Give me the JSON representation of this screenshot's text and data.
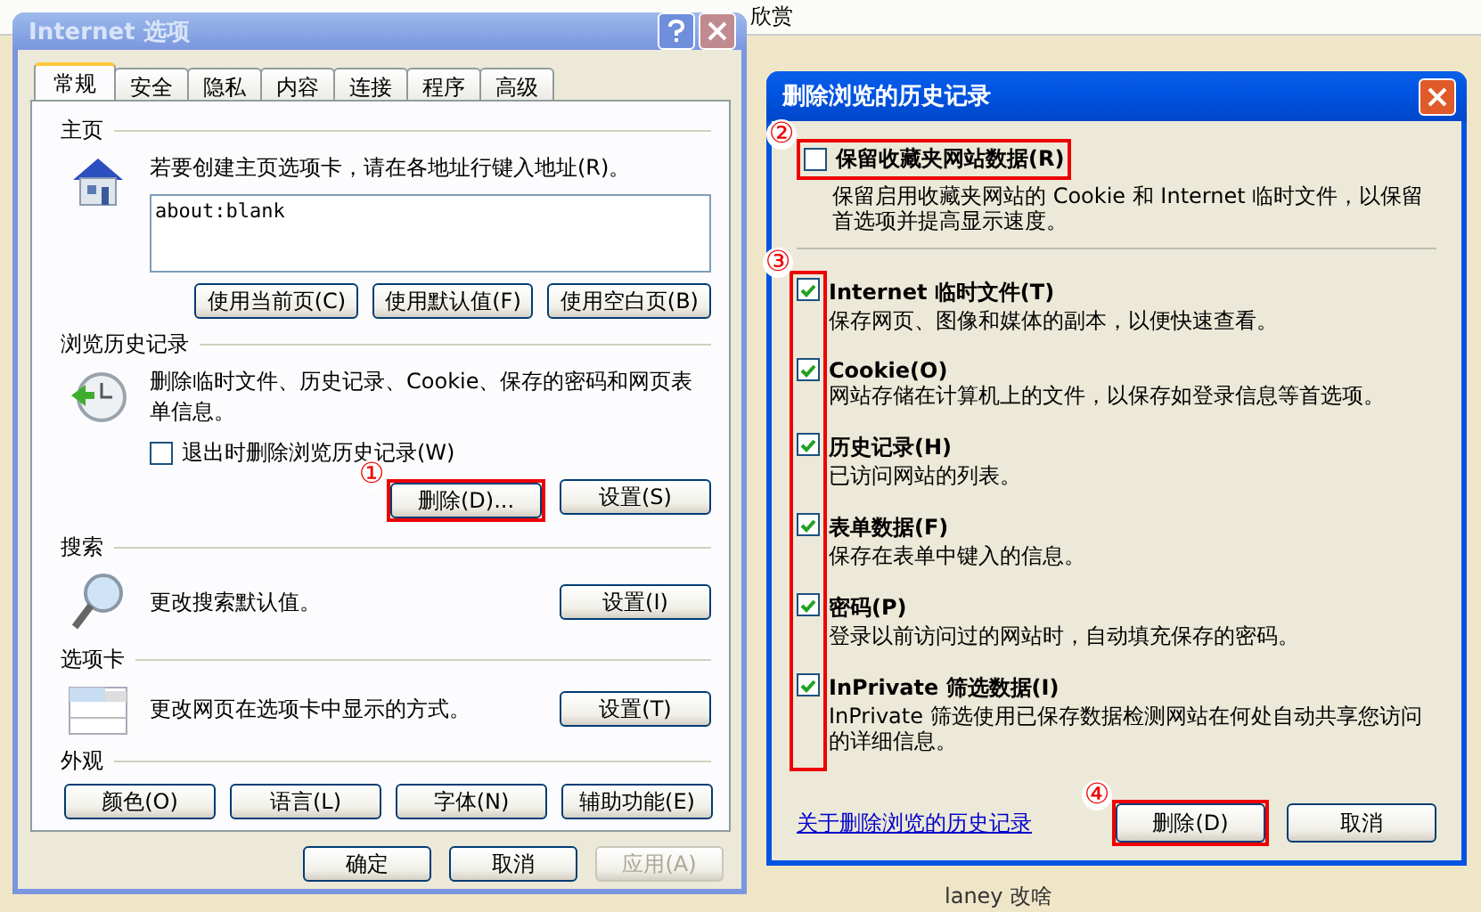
{
  "background": {
    "toolbar": [
      "欣赏"
    ],
    "comment": "laney 改啥"
  },
  "options_dialog": {
    "title": "Internet 选项",
    "active": false,
    "tabs": [
      {
        "label": "常规",
        "selected": true
      },
      {
        "label": "安全",
        "selected": false
      },
      {
        "label": "隐私",
        "selected": false
      },
      {
        "label": "内容",
        "selected": false
      },
      {
        "label": "连接",
        "selected": false
      },
      {
        "label": "程序",
        "selected": false
      },
      {
        "label": "高级",
        "selected": false
      }
    ],
    "home": {
      "heading": "主页",
      "text": "若要创建主页选项卡，请在各地址行键入地址(R)。",
      "value": "about:blank",
      "buttons": [
        {
          "label": "使用当前页(C)"
        },
        {
          "label": "使用默认值(F)"
        },
        {
          "label": "使用空白页(B)"
        }
      ]
    },
    "history": {
      "heading": "浏览历史记录",
      "text": "删除临时文件、历史记录、Cookie、保存的密码和网页表单信息。",
      "checkbox": {
        "label": "退出时删除浏览历史记录(W)",
        "checked": false
      },
      "buttons": [
        {
          "label": "删除(D)...",
          "marker": "①"
        },
        {
          "label": "设置(S)"
        }
      ]
    },
    "search": {
      "heading": "搜索",
      "text": "更改搜索默认值。",
      "button": "设置(I)"
    },
    "tabs_section": {
      "heading": "选项卡",
      "text": "更改网页在选项卡中显示的方式。",
      "button": "设置(T)"
    },
    "appearance": {
      "heading": "外观",
      "buttons": [
        "颜色(O)",
        "语言(L)",
        "字体(N)",
        "辅助功能(E)"
      ]
    },
    "footer": [
      {
        "label": "确定",
        "disabled": false
      },
      {
        "label": "取消",
        "disabled": false
      },
      {
        "label": "应用(A)",
        "disabled": true
      }
    ]
  },
  "delete_dialog": {
    "title": "删除浏览的历史记录",
    "active": true,
    "keep": {
      "label": "保留收藏夹网站数据(R)",
      "checked": false,
      "description": "保留启用收藏夹网站的 Cookie 和 Internet 临时文件，以保留首选项并提高显示速度。",
      "marker": "②"
    },
    "group_marker": "③",
    "items": [
      {
        "label": "Internet 临时文件(T)",
        "checked": true,
        "description": "保存网页、图像和媒体的副本，以便快速查看。"
      },
      {
        "label": "Cookie(O)",
        "checked": true,
        "description": "网站存储在计算机上的文件，以保存如登录信息等首选项。"
      },
      {
        "label": "历史记录(H)",
        "checked": true,
        "description": "已访问网站的列表。"
      },
      {
        "label": "表单数据(F)",
        "checked": true,
        "description": "保存在表单中键入的信息。"
      },
      {
        "label": "密码(P)",
        "checked": true,
        "description": "登录以前访问过的网站时，自动填充保存的密码。"
      },
      {
        "label": "InPrivate 筛选数据(I)",
        "checked": true,
        "description": "InPrivate 筛选使用已保存数据检测网站在何处自动共享您访问的详细信息。"
      }
    ],
    "link": "关于删除浏览的历史记录",
    "buttons": [
      {
        "label": "删除(D)",
        "marker": "④"
      },
      {
        "label": "取消"
      }
    ]
  }
}
